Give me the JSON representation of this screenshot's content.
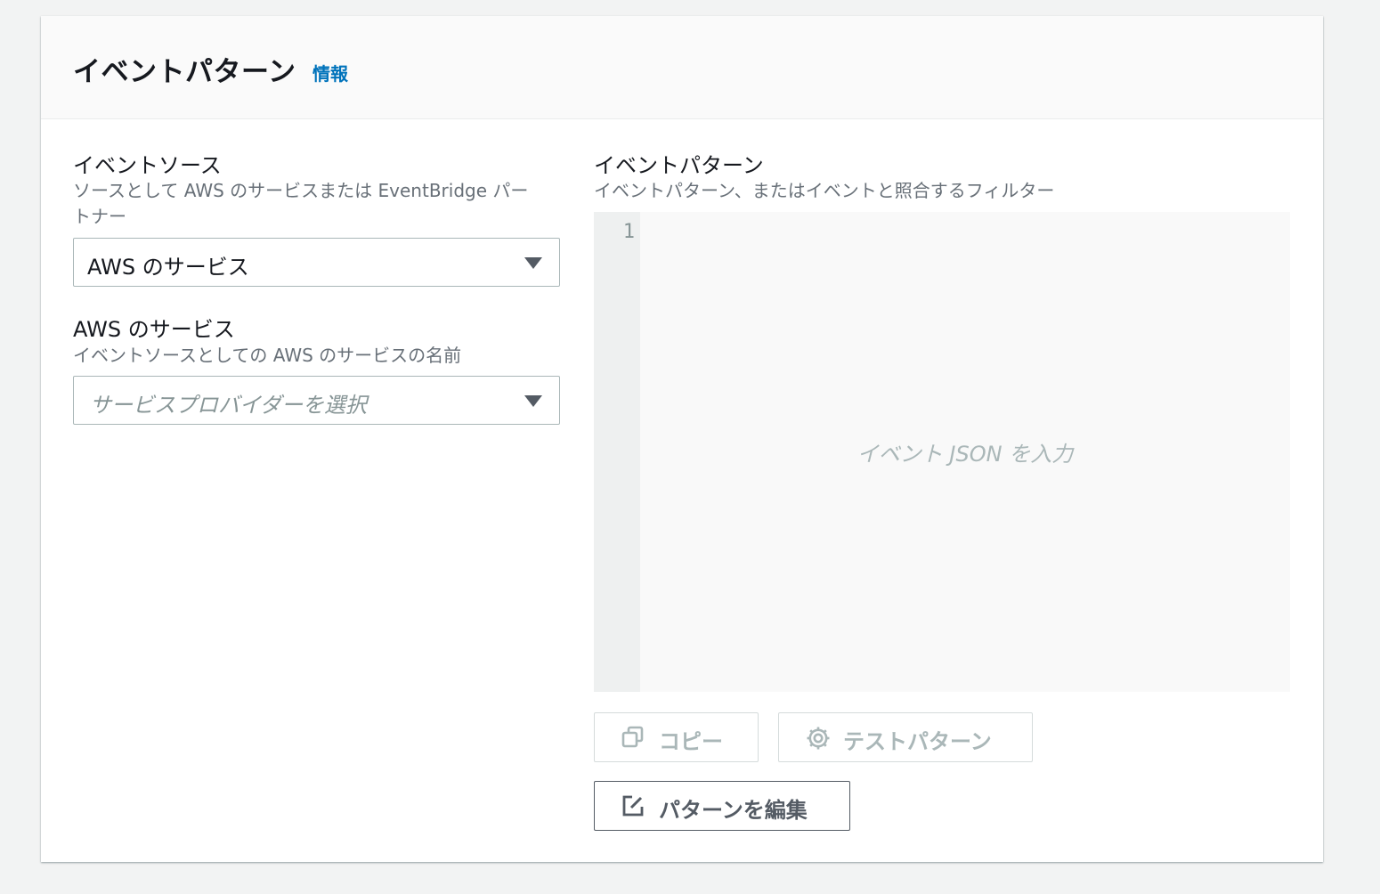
{
  "header": {
    "title": "イベントパターン",
    "info_link": "情報"
  },
  "event_source": {
    "label": "イベントソース",
    "description_line1": "ソースとして AWS のサービスまたは EventBridge パー",
    "description_line2": "トナー",
    "selected": "AWS のサービス"
  },
  "aws_service": {
    "label": "AWS のサービス",
    "description": "イベントソースとしての AWS のサービスの名前",
    "placeholder": "サービスプロバイダーを選択"
  },
  "event_pattern": {
    "label": "イベントパターン",
    "description": "イベントパターン、またはイベントと照合するフィルター",
    "line_number": "1",
    "editor_placeholder": "イベント JSON を入力"
  },
  "buttons": {
    "copy": "コピー",
    "test_pattern": "テストパターン",
    "edit_pattern": "パターンを編集"
  },
  "icons": {
    "copy": "copy-icon",
    "test": "gear-icon",
    "edit": "edit-icon"
  },
  "colors": {
    "link": "#0073bb",
    "disabled_text": "#aab7b8",
    "background": "#f2f3f3"
  }
}
